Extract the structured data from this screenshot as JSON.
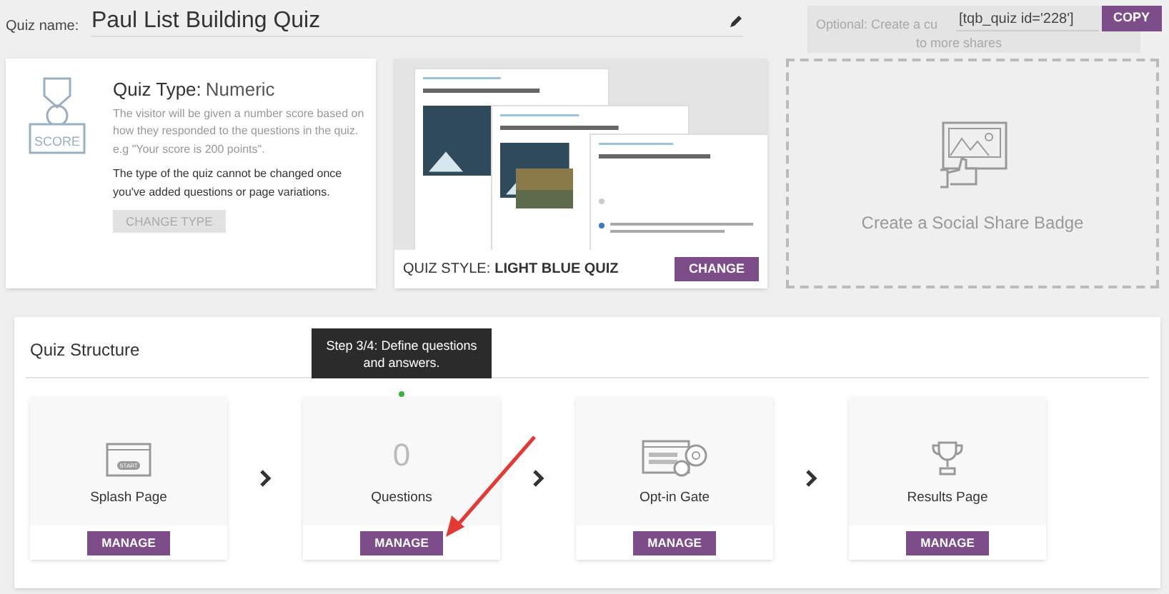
{
  "quiz_name": {
    "label": "Quiz name:",
    "value": "Paul List Building Quiz"
  },
  "shortcode": {
    "hint_lines": [
      "Optional: Create a cu",
      "to more shares"
    ],
    "code": "[tqb_quiz id='228']",
    "copy_button": "COPY"
  },
  "quiz_type": {
    "title": "Quiz Type:",
    "value": "Numeric",
    "icon_label": "SCORE",
    "description": "The visitor will be given a number score based on how they responded to the questions in the quiz. e.g \"Your score is 200 points\".",
    "note": "The type of the quiz cannot be changed once you've added questions or page variations.",
    "button": "CHANGE TYPE",
    "button_disabled": true
  },
  "quiz_style": {
    "label": "QUIZ STYLE:",
    "value": "LIGHT BLUE QUIZ",
    "button": "CHANGE"
  },
  "social_badge": {
    "label": "Create a Social Share Badge"
  },
  "structure": {
    "title": "Quiz Structure",
    "tooltip": "Step 3/4: Define questions and answers.",
    "steps": [
      {
        "kind": "splash",
        "icon_label": "START",
        "label": "Splash Page",
        "button": "MANAGE",
        "selected": false
      },
      {
        "kind": "count",
        "count": "0",
        "label": "Questions",
        "button": "MANAGE",
        "selected": true
      },
      {
        "kind": "optin",
        "label": "Opt-in Gate",
        "button": "MANAGE",
        "selected": false
      },
      {
        "kind": "results",
        "label": "Results Page",
        "button": "MANAGE",
        "selected": false
      }
    ]
  }
}
